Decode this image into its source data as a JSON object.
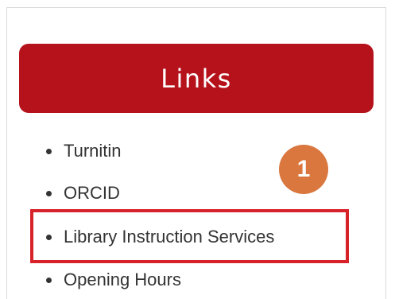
{
  "links_panel": {
    "title": "Links",
    "items": [
      {
        "label": "Turnitin"
      },
      {
        "label": "ORCID"
      },
      {
        "label": "Library Instruction Services"
      },
      {
        "label": "Opening Hours"
      }
    ]
  },
  "annotation": {
    "step_number": "1"
  },
  "colors": {
    "header_background": "#b5121b",
    "highlight_border": "#d8222a",
    "step_badge": "#d9773f",
    "link_text": "#333333"
  }
}
